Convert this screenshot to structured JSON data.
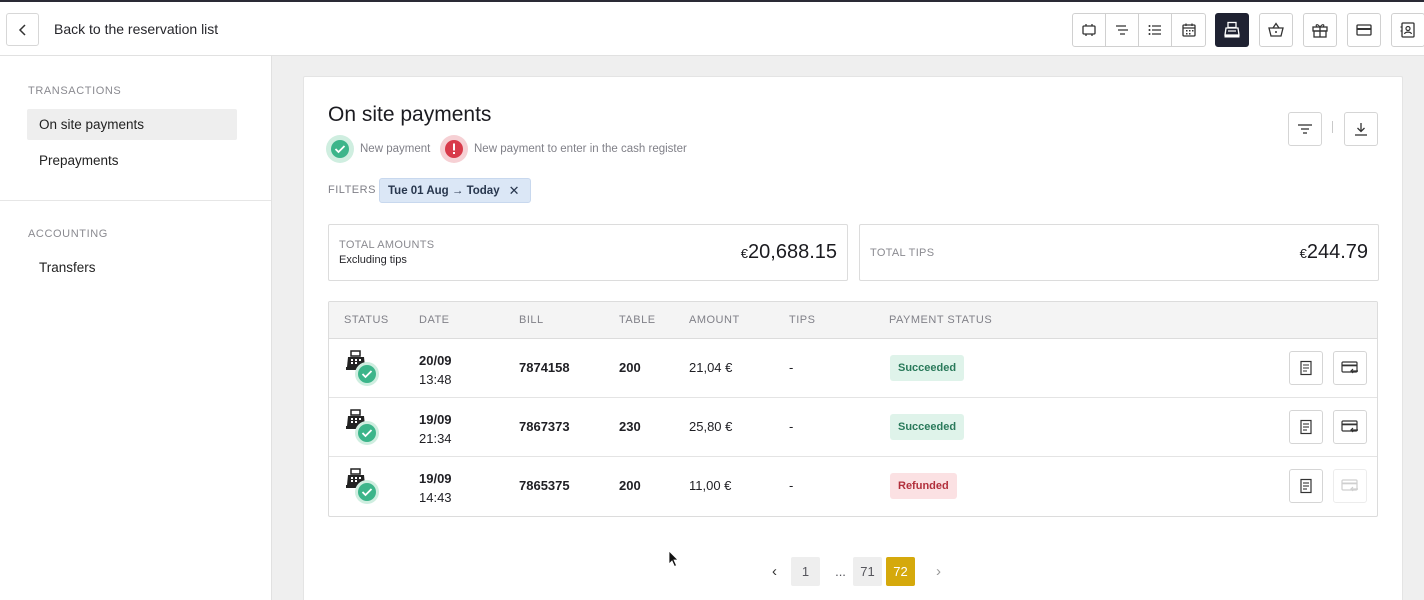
{
  "topbar": {
    "back_label": "Back to the reservation list",
    "toolbar_icons": [
      "floor-plan-icon",
      "timeline-icon",
      "list-icon",
      "calendar-icon",
      "cash-register-icon",
      "basket-icon",
      "gift-box-icon",
      "card-icon",
      "contact-book-icon"
    ],
    "active_icon": "cash-register-icon"
  },
  "sidebar": {
    "section_transactions": "TRANSACTIONS",
    "items_transactions": [
      "On site payments",
      "Prepayments"
    ],
    "section_accounting": "ACCOUNTING",
    "items_accounting": [
      "Transfers"
    ]
  },
  "main": {
    "title": "On site payments",
    "legend": {
      "new_payment": "New payment",
      "new_payment_cash": "New payment to enter in the cash register"
    },
    "filters_label": "FILTERS",
    "filter_chip": "Tue 01 Aug → Today",
    "stats": {
      "total_amounts_label": "TOTAL AMOUNTS",
      "total_amounts_sub": "Excluding tips",
      "total_amounts_currency": "€",
      "total_amounts_value": "20,688.15",
      "total_tips_label": "TOTAL TIPS",
      "total_tips_currency": "€",
      "total_tips_value": "244.79"
    },
    "table": {
      "headers": [
        "STATUS",
        "DATE",
        "BILL",
        "TABLE",
        "AMOUNT",
        "TIPS",
        "PAYMENT STATUS"
      ],
      "rows": [
        {
          "date": "20/09",
          "time": "13:48",
          "bill": "7874158",
          "table": "200",
          "amount": "21,04 €",
          "tips": "-",
          "status": "Succeeded"
        },
        {
          "date": "19/09",
          "time": "21:34",
          "bill": "7867373",
          "table": "230",
          "amount": "25,80 €",
          "tips": "-",
          "status": "Succeeded"
        },
        {
          "date": "19/09",
          "time": "14:43",
          "bill": "7865375",
          "table": "200",
          "amount": "11,00 €",
          "tips": "-",
          "status": "Refunded"
        }
      ]
    },
    "pagination": {
      "first": "1",
      "ellipsis": "...",
      "prev_page": "71",
      "current": "72"
    }
  },
  "colors": {
    "accent_dark": "#1f2232",
    "success_green": "#3cb58a",
    "error_red": "#d83a4a",
    "page_current": "#d5a90c",
    "chip_bg": "#dbe7f6"
  }
}
